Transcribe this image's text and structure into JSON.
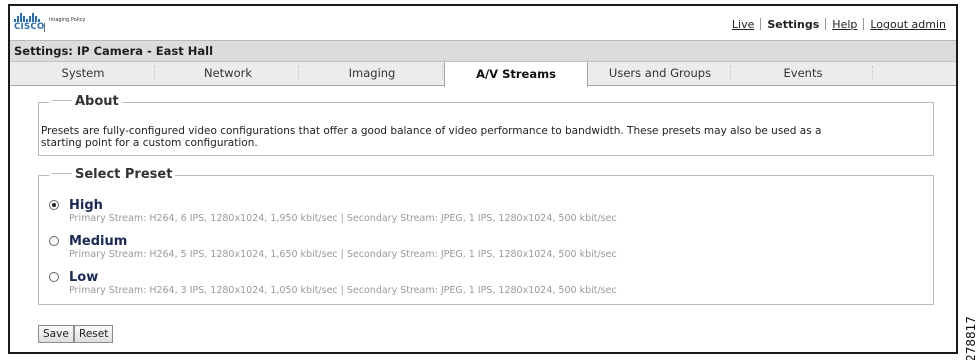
{
  "brand": {
    "logo_text": "CISCO",
    "tagline": "Imaging Policy"
  },
  "toplinks": {
    "live": "Live",
    "settings": "Settings",
    "help": "Help",
    "logout": "Logout admin"
  },
  "page_title": "Settings: IP Camera - East Hall",
  "tabs": [
    {
      "label": "System"
    },
    {
      "label": "Network"
    },
    {
      "label": "Imaging"
    },
    {
      "label": "A/V Streams",
      "active": true
    },
    {
      "label": "Users and Groups"
    },
    {
      "label": "Events"
    }
  ],
  "about": {
    "title": "About",
    "text": "Presets are fully-configured video configurations that offer a good balance of video performance to bandwidth. These presets may also be used as a starting point for a custom configuration."
  },
  "select_preset": {
    "title": "Select Preset",
    "options": [
      {
        "name": "High",
        "selected": true,
        "description": "Primary Stream: H264, 6 IPS, 1280x1024, 1,950 kbit/sec | Secondary Stream: JPEG, 1 IPS, 1280x1024, 500 kbit/sec"
      },
      {
        "name": "Medium",
        "selected": false,
        "description": "Primary Stream: H264, 5 IPS, 1280x1024, 1,650 kbit/sec | Secondary Stream: JPEG, 1 IPS, 1280x1024, 500 kbit/sec"
      },
      {
        "name": "Low",
        "selected": false,
        "description": "Primary Stream: H264, 3 IPS, 1280x1024, 1,050 kbit/sec | Secondary Stream: JPEG, 1 IPS, 1280x1024, 500 kbit/sec"
      }
    ]
  },
  "buttons": {
    "save": "Save",
    "reset": "Reset"
  },
  "figure_code": "278817",
  "colors": {
    "brand_blue": "#2a6fb5",
    "title_bar": "#dcdcdc",
    "preset_name": "#1a2a55"
  }
}
